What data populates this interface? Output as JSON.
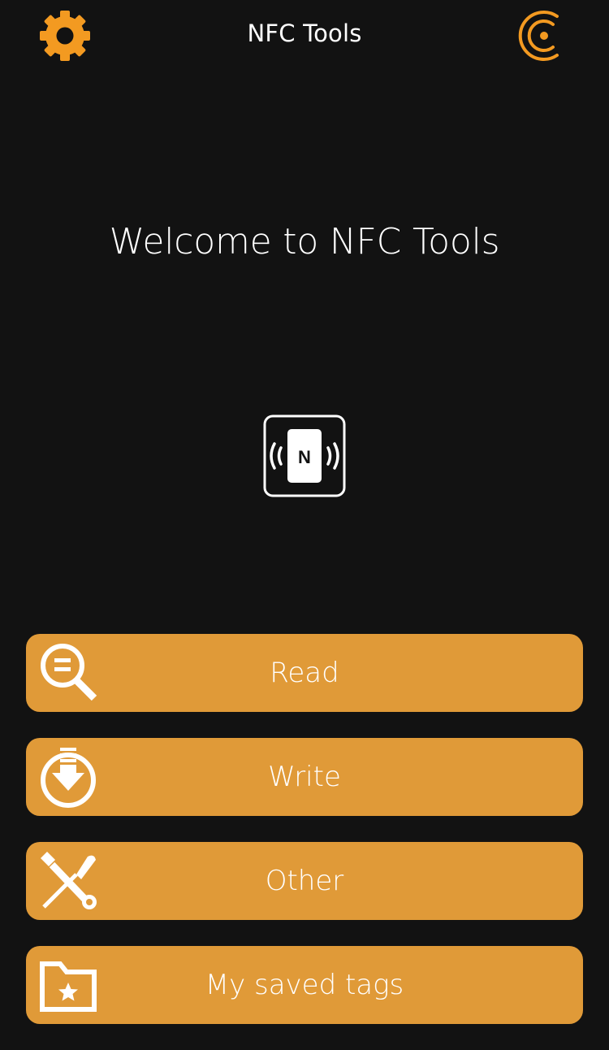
{
  "header": {
    "title": "NFC Tools",
    "settings_icon": "gear-icon",
    "brand_icon": "wakdev-logo-icon"
  },
  "welcome_text": "Welcome to NFC Tools",
  "nfc_logo_letter": "N",
  "menu": [
    {
      "label": "Read",
      "icon": "magnifier-read-icon"
    },
    {
      "label": "Write",
      "icon": "download-write-icon"
    },
    {
      "label": "Other",
      "icon": "tools-icon"
    },
    {
      "label": "My saved tags",
      "icon": "folder-star-icon"
    }
  ],
  "colors": {
    "background": "#121212",
    "accent": "#e09a38",
    "icon_orange": "#f39a21",
    "text": "#ffffff"
  }
}
